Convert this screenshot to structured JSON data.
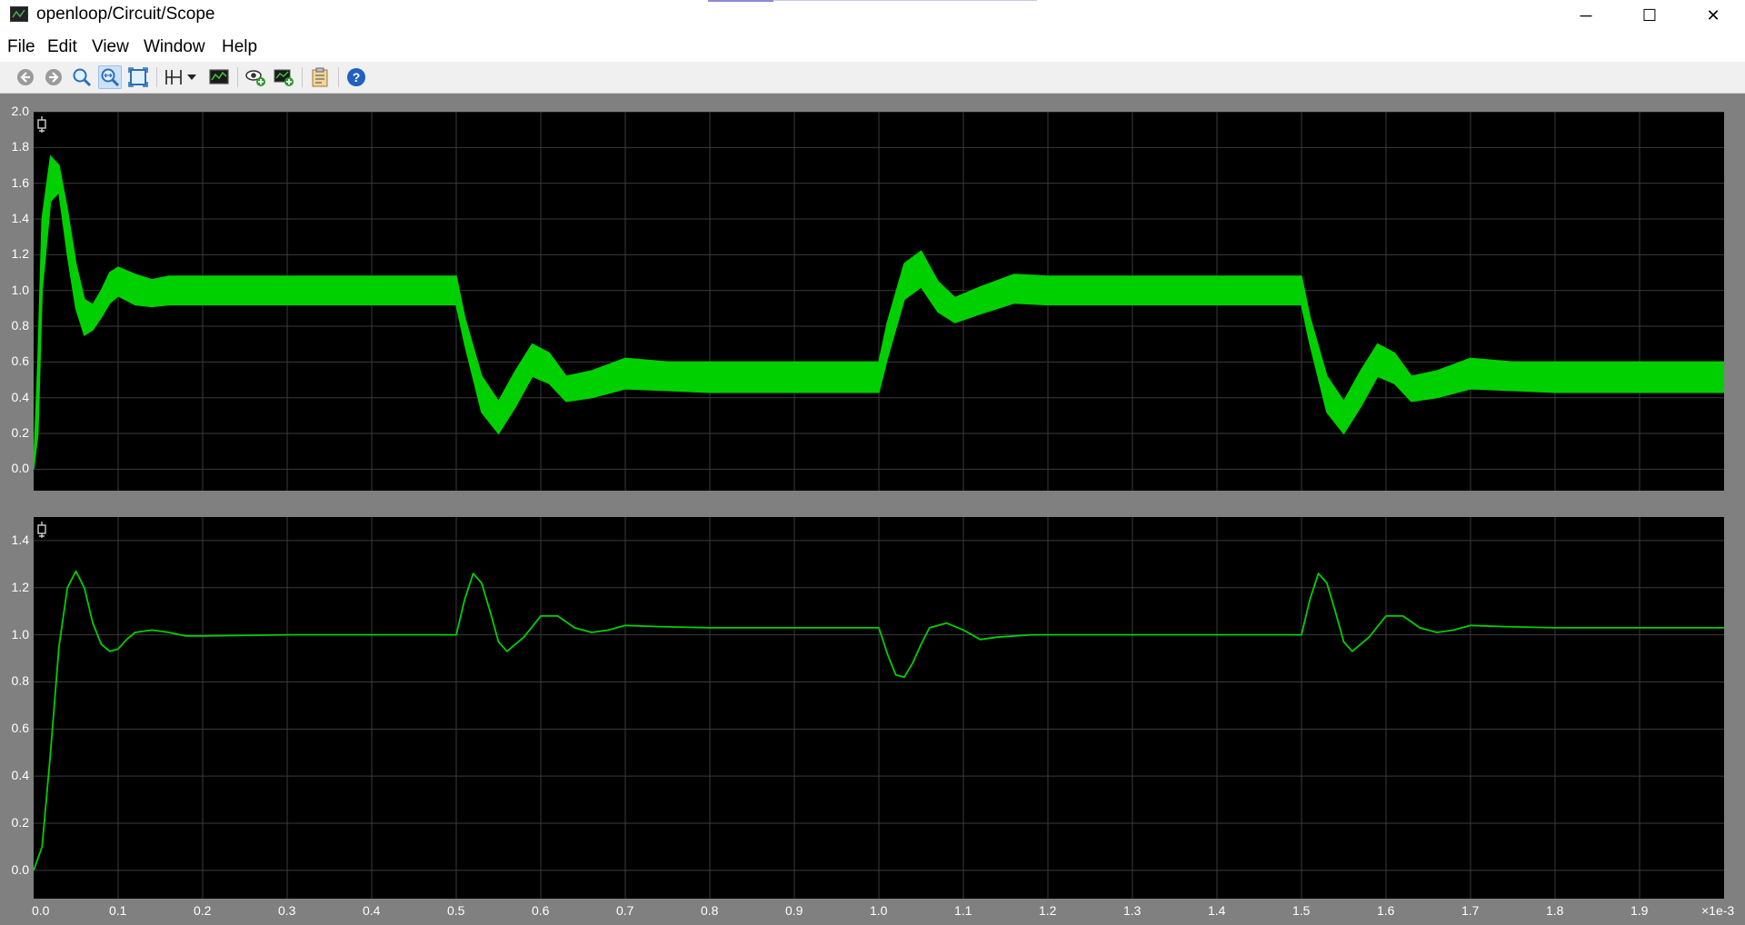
{
  "window": {
    "title": "openloop/Circuit/Scope",
    "controls": [
      "─",
      "☐",
      "✕"
    ]
  },
  "menu": [
    "File",
    "Edit",
    "View",
    "Window",
    "Help"
  ],
  "toolbar": [
    {
      "icon": "back-icon"
    },
    {
      "icon": "forward-icon"
    },
    {
      "icon": "zoom-in-icon"
    },
    {
      "icon": "zoom-x-icon",
      "active": true
    },
    {
      "icon": "fit-icon"
    },
    {
      "icon": "cursor-icon"
    },
    {
      "icon": "dropdown-icon"
    },
    {
      "icon": "display-icon"
    },
    {
      "icon": "view-add-icon"
    },
    {
      "icon": "export-icon"
    },
    {
      "icon": "clipboard-icon"
    },
    {
      "icon": "help-icon"
    }
  ],
  "x_axis": {
    "ticks": [
      "0.0",
      "0.1",
      "0.2",
      "0.3",
      "0.4",
      "0.5",
      "0.6",
      "0.7",
      "0.8",
      "0.9",
      "1.0",
      "1.1",
      "1.2",
      "1.3",
      "1.4",
      "1.5",
      "1.6",
      "1.7",
      "1.8",
      "1.9"
    ],
    "multiplier": "×1e-3"
  },
  "colors": {
    "trace": "#00d000",
    "background": "#000000",
    "grid": "#3a3a3a",
    "frame": "#808080"
  },
  "chart_data": [
    {
      "type": "line",
      "xlim": [
        0,
        2
      ],
      "ylim": [
        -0.12,
        2.0
      ],
      "yticks": [
        "2.0",
        "1.8",
        "1.6",
        "1.4",
        "1.2",
        "1.0",
        "0.8",
        "0.6",
        "0.4",
        "0.2",
        "0.0"
      ],
      "grid": true,
      "series": [
        {
          "ripple_envelope": true,
          "x": [
            0.0,
            0.005,
            0.01,
            0.02,
            0.03,
            0.04,
            0.05,
            0.06,
            0.07,
            0.08,
            0.09,
            0.1,
            0.12,
            0.14,
            0.16,
            0.2,
            0.3,
            0.4,
            0.5,
            0.51,
            0.53,
            0.55,
            0.57,
            0.59,
            0.61,
            0.63,
            0.66,
            0.7,
            0.75,
            0.8,
            0.9,
            1.0,
            1.01,
            1.03,
            1.05,
            1.07,
            1.09,
            1.12,
            1.16,
            1.2,
            1.3,
            1.4,
            1.5,
            1.51,
            1.53,
            1.55,
            1.57,
            1.59,
            1.61,
            1.63,
            1.66,
            1.7,
            1.75,
            1.8,
            1.9,
            2.0
          ],
          "upper": [
            0.0,
            0.6,
            1.4,
            1.75,
            1.7,
            1.45,
            1.15,
            0.95,
            0.92,
            1.0,
            1.1,
            1.13,
            1.09,
            1.06,
            1.08,
            1.08,
            1.08,
            1.08,
            1.08,
            0.85,
            0.52,
            0.38,
            0.55,
            0.7,
            0.65,
            0.52,
            0.55,
            0.62,
            0.6,
            0.6,
            0.6,
            0.6,
            0.82,
            1.15,
            1.22,
            1.05,
            0.96,
            1.02,
            1.09,
            1.08,
            1.08,
            1.08,
            1.08,
            0.85,
            0.52,
            0.38,
            0.55,
            0.7,
            0.65,
            0.52,
            0.55,
            0.62,
            0.6,
            0.6,
            0.6,
            0.6
          ],
          "lower": [
            0.0,
            0.2,
            1.0,
            1.5,
            1.55,
            1.2,
            0.9,
            0.75,
            0.78,
            0.85,
            0.93,
            0.97,
            0.92,
            0.91,
            0.92,
            0.92,
            0.92,
            0.92,
            0.92,
            0.7,
            0.32,
            0.2,
            0.35,
            0.52,
            0.48,
            0.38,
            0.4,
            0.45,
            0.44,
            0.43,
            0.43,
            0.43,
            0.62,
            0.95,
            1.02,
            0.88,
            0.82,
            0.87,
            0.93,
            0.92,
            0.92,
            0.92,
            0.92,
            0.7,
            0.32,
            0.2,
            0.35,
            0.52,
            0.48,
            0.38,
            0.4,
            0.45,
            0.44,
            0.43,
            0.43,
            0.43
          ]
        }
      ]
    },
    {
      "type": "line",
      "xlim": [
        0,
        2
      ],
      "ylim": [
        -0.12,
        1.5
      ],
      "yticks": [
        "1.4",
        "1.2",
        "1.0",
        "0.8",
        "0.6",
        "0.4",
        "0.2",
        "0.0"
      ],
      "grid": true,
      "series": [
        {
          "x": [
            0.0,
            0.01,
            0.02,
            0.03,
            0.04,
            0.05,
            0.06,
            0.07,
            0.08,
            0.09,
            0.1,
            0.11,
            0.12,
            0.14,
            0.16,
            0.18,
            0.2,
            0.3,
            0.4,
            0.5,
            0.51,
            0.52,
            0.53,
            0.54,
            0.55,
            0.56,
            0.58,
            0.6,
            0.62,
            0.64,
            0.66,
            0.68,
            0.7,
            0.74,
            0.8,
            0.9,
            1.0,
            1.01,
            1.02,
            1.03,
            1.04,
            1.05,
            1.06,
            1.08,
            1.1,
            1.12,
            1.14,
            1.18,
            1.2,
            1.3,
            1.4,
            1.5,
            1.51,
            1.52,
            1.53,
            1.54,
            1.55,
            1.56,
            1.58,
            1.6,
            1.62,
            1.64,
            1.66,
            1.68,
            1.7,
            1.74,
            1.8,
            1.9,
            2.0
          ],
          "y": [
            0.0,
            0.1,
            0.5,
            0.95,
            1.2,
            1.27,
            1.2,
            1.05,
            0.96,
            0.93,
            0.94,
            0.98,
            1.01,
            1.02,
            1.01,
            0.995,
            0.995,
            1.0,
            1.0,
            1.0,
            1.15,
            1.26,
            1.22,
            1.1,
            0.97,
            0.93,
            0.99,
            1.08,
            1.08,
            1.03,
            1.01,
            1.02,
            1.04,
            1.035,
            1.03,
            1.03,
            1.03,
            0.92,
            0.83,
            0.82,
            0.88,
            0.96,
            1.03,
            1.05,
            1.02,
            0.98,
            0.99,
            1.0,
            1.0,
            1.0,
            1.0,
            1.0,
            1.15,
            1.26,
            1.22,
            1.1,
            0.97,
            0.93,
            0.99,
            1.08,
            1.08,
            1.03,
            1.01,
            1.02,
            1.04,
            1.035,
            1.03,
            1.03,
            1.03
          ]
        }
      ]
    }
  ]
}
